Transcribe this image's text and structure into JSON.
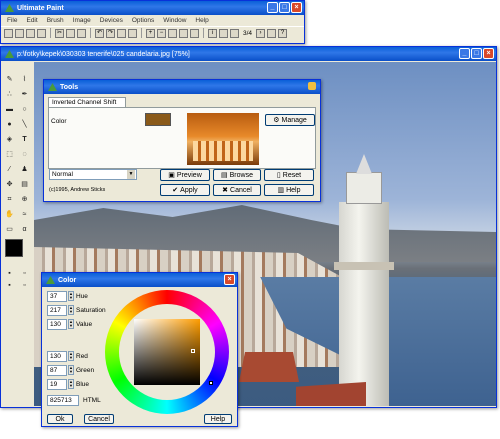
{
  "main_window": {
    "title": "Ultimate Paint",
    "menu": [
      "File",
      "Edit",
      "Brush",
      "Image",
      "Devices",
      "Options",
      "Window",
      "Help"
    ],
    "page_indicator": "3/4"
  },
  "doc_window": {
    "title": "p:\\fotky\\kepek\\030303 tenerife\\025 candelaria.jpg [75%]"
  },
  "tools_dialog": {
    "title": "Tools",
    "tab": "Inverted Channel Shift",
    "color_label": "Color",
    "swatch_color": "#8a5a1a",
    "manage": "Manage",
    "mode": "Normal",
    "preview": "Preview",
    "browse": "Browse",
    "reset": "Reset",
    "apply": "Apply",
    "cancel": "Cancel",
    "help": "Help",
    "copyright": "(c)1995, Andrew Sticks"
  },
  "color_dialog": {
    "title": "Color",
    "hue": "37",
    "hue_label": "Hue",
    "saturation": "217",
    "saturation_label": "Saturation",
    "value": "130",
    "value_label": "Value",
    "red": "130",
    "red_label": "Red",
    "green": "87",
    "green_label": "Green",
    "blue": "19",
    "blue_label": "Blue",
    "html": "825713",
    "html_label": "HTML",
    "ok": "Ok",
    "cancel": "Cancel",
    "help": "Help"
  },
  "colors": {
    "foreground": "#000000",
    "background": "#ffffff",
    "accent": "#0a5fd8"
  }
}
